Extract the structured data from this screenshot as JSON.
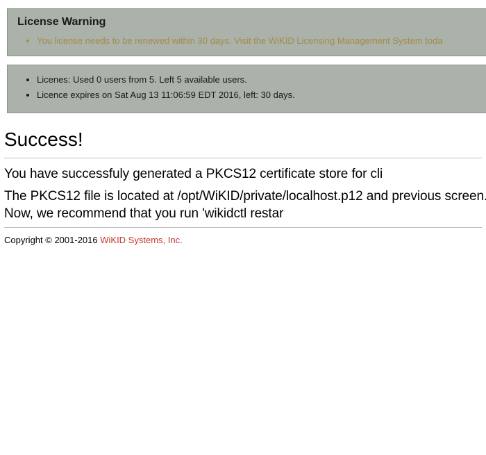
{
  "warning": {
    "title": "License Warning",
    "items": [
      "You license needs to be renewed within 30 days. Visit the WiKID Licensing Management System toda"
    ]
  },
  "status": {
    "items": [
      "Licenes: Used 0 users from 5. Left 5 available users.",
      "Licence expires on Sat Aug 13 11:06:59 EDT 2016, left: 30 days."
    ]
  },
  "main": {
    "heading": "Success!",
    "paragraphs": [
      "You have successfuly generated a PKCS12 certificate store for cli",
      "The PKCS12 file is located at /opt/WiKID/private/localhost.p12 and previous screen. Now, we recommend that you run 'wikidctl restar"
    ]
  },
  "footer": {
    "copyright": "Copyright © 2001-2016 ",
    "link_text": "WiKID Systems, Inc."
  }
}
